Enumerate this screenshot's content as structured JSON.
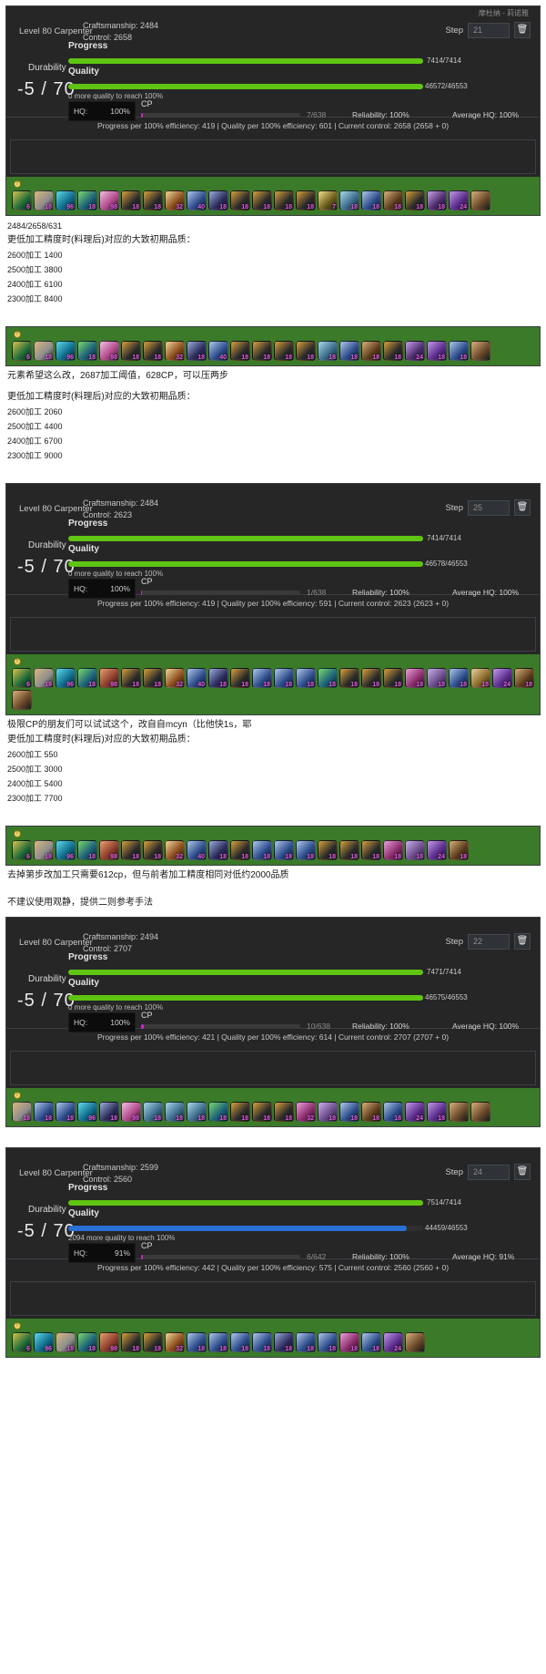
{
  "panels": [
    {
      "id": "panel-1",
      "server": "摩杜纳 - 莉诺雅",
      "job": "Level 80 Carpenter",
      "craftsmanship_label": "Craftsmanship: 2484",
      "control_label": "Control: 2658",
      "step_label": "Step",
      "step_value": "21",
      "progress_label": "Progress",
      "quality_label": "Quality",
      "durability_label": "Durability",
      "durability_value": "-5 / 70",
      "progress_text": "7414/7414",
      "progress_pct": 100,
      "quality_text": "46572/46553",
      "quality_pct": 100,
      "quality_note": "0 more quality to reach 100%",
      "hq_label": "HQ:",
      "hq_value": "100%",
      "cp_label": "CP",
      "cp_text": "7/638",
      "cp_pct": 1,
      "reliability": "Reliability: 100%",
      "average_hq": "Average HQ: 100%",
      "efficiency": "Progress per 100% efficiency: 419 | Quality per 100% efficiency: 601 | Current control: 2658 (2658 + 0)",
      "quality_bar_color": "#5fc412",
      "actions": [
        {
          "cost": "6",
          "c1": "#1f6b3a",
          "c2": "#d8c34a"
        },
        {
          "cost": "18",
          "c1": "#8d8d8d",
          "c2": "#d8b77a"
        },
        {
          "cost": "96",
          "c1": "#0e6a8a",
          "c2": "#5fd8e8"
        },
        {
          "cost": "18",
          "c1": "#1a5f7a",
          "c2": "#7ad86a"
        },
        {
          "cost": "98",
          "c1": "#b0468a",
          "c2": "#f0c0e0"
        },
        {
          "cost": "18",
          "c1": "#2a2a2a",
          "c2": "#d8a03a"
        },
        {
          "cost": "18",
          "c1": "#2a2a2a",
          "c2": "#d8a03a"
        },
        {
          "cost": "32",
          "c1": "#8a4a1a",
          "c2": "#f0d89a"
        },
        {
          "cost": "40",
          "c1": "#2a4a8a",
          "c2": "#b0c8e8"
        },
        {
          "cost": "18",
          "c1": "#2a2a5a",
          "c2": "#9aaed8"
        },
        {
          "cost": "18",
          "c1": "#2a2a2a",
          "c2": "#d8a03a"
        },
        {
          "cost": "18",
          "c1": "#2a2a2a",
          "c2": "#d8a03a"
        },
        {
          "cost": "18",
          "c1": "#2a2a2a",
          "c2": "#d8a03a"
        },
        {
          "cost": "18",
          "c1": "#2a2a2a",
          "c2": "#d8a03a"
        },
        {
          "cost": "7",
          "c1": "#6a5a1a",
          "c2": "#f0e08a"
        },
        {
          "cost": "18",
          "c1": "#3a6a8a",
          "c2": "#a8d8e8"
        },
        {
          "cost": "18",
          "c1": "#2a4a8a",
          "c2": "#b0c8e8"
        },
        {
          "cost": "18",
          "c1": "#5a3a1a",
          "c2": "#d8b07a"
        },
        {
          "cost": "18",
          "c1": "#2a2a2a",
          "c2": "#d8a03a"
        },
        {
          "cost": "18",
          "c1": "#4a2a6a",
          "c2": "#c8a0e8"
        },
        {
          "cost": "24",
          "c1": "#5a2a8a",
          "c2": "#c09ae8"
        },
        {
          "cost": "",
          "c1": "#6a4a2a",
          "c2": "#d8b07a"
        }
      ]
    },
    {
      "id": "panel-2",
      "actions": [
        {
          "cost": "6",
          "c1": "#1f6b3a",
          "c2": "#d8c34a"
        },
        {
          "cost": "18",
          "c1": "#8d8d8d",
          "c2": "#d8b77a"
        },
        {
          "cost": "96",
          "c1": "#0e6a8a",
          "c2": "#5fd8e8"
        },
        {
          "cost": "18",
          "c1": "#1a5f7a",
          "c2": "#7ad86a"
        },
        {
          "cost": "98",
          "c1": "#b0468a",
          "c2": "#f0c0e0"
        },
        {
          "cost": "18",
          "c1": "#2a2a2a",
          "c2": "#d8a03a"
        },
        {
          "cost": "18",
          "c1": "#2a2a2a",
          "c2": "#d8a03a"
        },
        {
          "cost": "32",
          "c1": "#8a4a1a",
          "c2": "#f0d89a"
        },
        {
          "cost": "18",
          "c1": "#2a2a5a",
          "c2": "#9aaed8"
        },
        {
          "cost": "40",
          "c1": "#2a4a8a",
          "c2": "#b0c8e8"
        },
        {
          "cost": "18",
          "c1": "#2a2a2a",
          "c2": "#d8a03a"
        },
        {
          "cost": "18",
          "c1": "#2a2a2a",
          "c2": "#d8a03a"
        },
        {
          "cost": "18",
          "c1": "#2a2a2a",
          "c2": "#d8a03a"
        },
        {
          "cost": "18",
          "c1": "#2a2a2a",
          "c2": "#d8a03a"
        },
        {
          "cost": "18",
          "c1": "#3a6a8a",
          "c2": "#a8d8e8"
        },
        {
          "cost": "18",
          "c1": "#2a4a8a",
          "c2": "#b0c8e8"
        },
        {
          "cost": "18",
          "c1": "#5a3a1a",
          "c2": "#d8b07a"
        },
        {
          "cost": "18",
          "c1": "#2a2a2a",
          "c2": "#d8a03a"
        },
        {
          "cost": "24",
          "c1": "#4a2a6a",
          "c2": "#c8a0e8"
        },
        {
          "cost": "18",
          "c1": "#5a2a8a",
          "c2": "#c09ae8"
        },
        {
          "cost": "18",
          "c1": "#2a4a8a",
          "c2": "#b0c8e8"
        },
        {
          "cost": "",
          "c1": "#6a4a2a",
          "c2": "#d8b07a"
        }
      ]
    },
    {
      "id": "panel-3",
      "job": "Level 80 Carpenter",
      "craftsmanship_label": "Craftsmanship: 2484",
      "control_label": "Control: 2623",
      "step_label": "Step",
      "step_value": "25",
      "progress_label": "Progress",
      "quality_label": "Quality",
      "durability_label": "Durability",
      "durability_value": "-5 / 70",
      "progress_text": "7414/7414",
      "progress_pct": 100,
      "quality_text": "46578/46553",
      "quality_pct": 100,
      "quality_note": "0 more quality to reach 100%",
      "hq_label": "HQ:",
      "hq_value": "100%",
      "cp_label": "CP",
      "cp_text": "1/638",
      "cp_pct": 0.5,
      "reliability": "Reliability: 100%",
      "average_hq": "Average HQ: 100%",
      "efficiency": "Progress per 100% efficiency: 419 | Quality per 100% efficiency: 591 | Current control: 2623 (2623 + 0)",
      "quality_bar_color": "#5fc412",
      "actions": [
        {
          "cost": "6",
          "c1": "#1f6b3a",
          "c2": "#d8c34a"
        },
        {
          "cost": "18",
          "c1": "#8d8d8d",
          "c2": "#d8b77a"
        },
        {
          "cost": "96",
          "c1": "#0e6a8a",
          "c2": "#5fd8e8"
        },
        {
          "cost": "18",
          "c1": "#1a5f7a",
          "c2": "#7ad86a"
        },
        {
          "cost": "98",
          "c1": "#8a3a2a",
          "c2": "#e8a070"
        },
        {
          "cost": "18",
          "c1": "#2a2a2a",
          "c2": "#d8a03a"
        },
        {
          "cost": "18",
          "c1": "#2a2a2a",
          "c2": "#d8a03a"
        },
        {
          "cost": "32",
          "c1": "#8a4a1a",
          "c2": "#f0d89a"
        },
        {
          "cost": "40",
          "c1": "#2a4a8a",
          "c2": "#b0c8e8"
        },
        {
          "cost": "18",
          "c1": "#2a2a5a",
          "c2": "#9aaed8"
        },
        {
          "cost": "18",
          "c1": "#2a2a2a",
          "c2": "#d8a03a"
        },
        {
          "cost": "18",
          "c1": "#2a4a8a",
          "c2": "#b0c8e8"
        },
        {
          "cost": "18",
          "c1": "#2a4a8a",
          "c2": "#b0c8e8"
        },
        {
          "cost": "18",
          "c1": "#2a4a8a",
          "c2": "#b0c8e8"
        },
        {
          "cost": "18",
          "c1": "#1a5f7a",
          "c2": "#7ad86a"
        },
        {
          "cost": "18",
          "c1": "#2a2a2a",
          "c2": "#d8a03a"
        },
        {
          "cost": "18",
          "c1": "#2a2a2a",
          "c2": "#d8a03a"
        },
        {
          "cost": "18",
          "c1": "#2a2a2a",
          "c2": "#d8a03a"
        },
        {
          "cost": "18",
          "c1": "#8a2a6a",
          "c2": "#e8a0d8"
        },
        {
          "cost": "18",
          "c1": "#6a4a8a",
          "c2": "#c8b0e8"
        },
        {
          "cost": "18",
          "c1": "#2a4a8a",
          "c2": "#b0c8e8"
        },
        {
          "cost": "18",
          "c1": "#8a6a2a",
          "c2": "#e8d09a"
        },
        {
          "cost": "24",
          "c1": "#5a2a8a",
          "c2": "#c09ae8"
        },
        {
          "cost": "18",
          "c1": "#5a3a1a",
          "c2": "#d8b07a"
        },
        {
          "cost": "",
          "c1": "#6a4a2a",
          "c2": "#d8b07a"
        }
      ]
    },
    {
      "id": "panel-4",
      "actions": [
        {
          "cost": "6",
          "c1": "#1f6b3a",
          "c2": "#d8c34a"
        },
        {
          "cost": "18",
          "c1": "#8d8d8d",
          "c2": "#d8b77a"
        },
        {
          "cost": "96",
          "c1": "#0e6a8a",
          "c2": "#5fd8e8"
        },
        {
          "cost": "18",
          "c1": "#1a5f7a",
          "c2": "#7ad86a"
        },
        {
          "cost": "98",
          "c1": "#8a3a2a",
          "c2": "#e8a070"
        },
        {
          "cost": "18",
          "c1": "#2a2a2a",
          "c2": "#d8a03a"
        },
        {
          "cost": "18",
          "c1": "#2a2a2a",
          "c2": "#d8a03a"
        },
        {
          "cost": "32",
          "c1": "#8a4a1a",
          "c2": "#f0d89a"
        },
        {
          "cost": "40",
          "c1": "#2a4a8a",
          "c2": "#b0c8e8"
        },
        {
          "cost": "18",
          "c1": "#2a2a5a",
          "c2": "#9aaed8"
        },
        {
          "cost": "18",
          "c1": "#2a2a2a",
          "c2": "#d8a03a"
        },
        {
          "cost": "18",
          "c1": "#2a4a8a",
          "c2": "#b0c8e8"
        },
        {
          "cost": "18",
          "c1": "#2a4a8a",
          "c2": "#b0c8e8"
        },
        {
          "cost": "18",
          "c1": "#2a4a8a",
          "c2": "#b0c8e8"
        },
        {
          "cost": "18",
          "c1": "#2a2a2a",
          "c2": "#d8a03a"
        },
        {
          "cost": "18",
          "c1": "#2a2a2a",
          "c2": "#d8a03a"
        },
        {
          "cost": "18",
          "c1": "#2a2a2a",
          "c2": "#d8a03a"
        },
        {
          "cost": "18",
          "c1": "#8a2a6a",
          "c2": "#e8a0d8"
        },
        {
          "cost": "18",
          "c1": "#6a4a8a",
          "c2": "#c8b0e8"
        },
        {
          "cost": "24",
          "c1": "#5a2a8a",
          "c2": "#c09ae8"
        },
        {
          "cost": "18",
          "c1": "#5a3a1a",
          "c2": "#d8b07a"
        }
      ]
    },
    {
      "id": "panel-5",
      "job": "Level 80 Carpenter",
      "craftsmanship_label": "Craftsmanship: 2494",
      "control_label": "Control: 2707",
      "step_label": "Step",
      "step_value": "22",
      "progress_label": "Progress",
      "quality_label": "Quality",
      "durability_label": "Durability",
      "durability_value": "-5 / 70",
      "progress_text": "7471/7414",
      "progress_pct": 100,
      "quality_text": "46575/46553",
      "quality_pct": 100,
      "quality_note": "0 more quality to reach 100%",
      "hq_label": "HQ:",
      "hq_value": "100%",
      "cp_label": "CP",
      "cp_text": "10/638",
      "cp_pct": 1.5,
      "reliability": "Reliability: 100%",
      "average_hq": "Average HQ: 100%",
      "efficiency": "Progress per 100% efficiency: 421 | Quality per 100% efficiency: 614 | Current control: 2707 (2707 + 0)",
      "quality_bar_color": "#5fc412",
      "actions": [
        {
          "cost": "18",
          "c1": "#8d8d8d",
          "c2": "#d8b77a"
        },
        {
          "cost": "18",
          "c1": "#2a4a8a",
          "c2": "#b0c8e8"
        },
        {
          "cost": "18",
          "c1": "#2a4a8a",
          "c2": "#b0c8e8"
        },
        {
          "cost": "96",
          "c1": "#0e6a8a",
          "c2": "#5fd8e8"
        },
        {
          "cost": "18",
          "c1": "#2a2a5a",
          "c2": "#9aaed8"
        },
        {
          "cost": "98",
          "c1": "#b0468a",
          "c2": "#f0c0e0"
        },
        {
          "cost": "18",
          "c1": "#3a6a8a",
          "c2": "#a8d8e8"
        },
        {
          "cost": "18",
          "c1": "#3a6a8a",
          "c2": "#a8d8e8"
        },
        {
          "cost": "18",
          "c1": "#3a6a8a",
          "c2": "#a8d8e8"
        },
        {
          "cost": "18",
          "c1": "#1a5f7a",
          "c2": "#7ad86a"
        },
        {
          "cost": "18",
          "c1": "#2a2a2a",
          "c2": "#d8a03a"
        },
        {
          "cost": "18",
          "c1": "#2a2a2a",
          "c2": "#d8a03a"
        },
        {
          "cost": "18",
          "c1": "#2a2a2a",
          "c2": "#d8a03a"
        },
        {
          "cost": "32",
          "c1": "#8a2a6a",
          "c2": "#e8a0d8"
        },
        {
          "cost": "18",
          "c1": "#6a4a8a",
          "c2": "#c8b0e8"
        },
        {
          "cost": "18",
          "c1": "#2a4a8a",
          "c2": "#b0c8e8"
        },
        {
          "cost": "18",
          "c1": "#5a3a1a",
          "c2": "#d8b07a"
        },
        {
          "cost": "18",
          "c1": "#2a4a8a",
          "c2": "#b0c8e8"
        },
        {
          "cost": "24",
          "c1": "#5a2a8a",
          "c2": "#c09ae8"
        },
        {
          "cost": "18",
          "c1": "#5a2a8a",
          "c2": "#c09ae8"
        },
        {
          "cost": "",
          "c1": "#6a4a2a",
          "c2": "#d8b07a"
        },
        {
          "cost": "",
          "c1": "#6a4a2a",
          "c2": "#d8b07a"
        }
      ]
    },
    {
      "id": "panel-6",
      "job": "Level 80 Carpenter",
      "craftsmanship_label": "Craftsmanship: 2599",
      "control_label": "Control: 2560",
      "step_label": "Step",
      "step_value": "24",
      "progress_label": "Progress",
      "quality_label": "Quality",
      "durability_label": "Durability",
      "durability_value": "-5 / 70",
      "progress_text": "7514/7414",
      "progress_pct": 100,
      "quality_text": "44459/46553",
      "quality_pct": 95.5,
      "quality_note": "2094 more quality to reach 100%",
      "hq_label": "HQ:",
      "hq_value": "91%",
      "cp_label": "CP",
      "cp_text": "6/642",
      "cp_pct": 1,
      "reliability": "Reliability: 100%",
      "average_hq": "Average HQ: 91%",
      "efficiency": "Progress per 100% efficiency: 442 | Quality per 100% efficiency: 575 | Current control: 2560 (2560 + 0)",
      "quality_bar_color": "#2a6fd6",
      "actions": [
        {
          "cost": "6",
          "c1": "#1f6b3a",
          "c2": "#d8c34a"
        },
        {
          "cost": "96",
          "c1": "#0e6a8a",
          "c2": "#5fd8e8"
        },
        {
          "cost": "18",
          "c1": "#8d8d8d",
          "c2": "#d8b77a"
        },
        {
          "cost": "18",
          "c1": "#1a5f7a",
          "c2": "#7ad86a"
        },
        {
          "cost": "98",
          "c1": "#8a3a2a",
          "c2": "#e8a070"
        },
        {
          "cost": "18",
          "c1": "#2a2a2a",
          "c2": "#d8a03a"
        },
        {
          "cost": "18",
          "c1": "#2a2a2a",
          "c2": "#d8a03a"
        },
        {
          "cost": "32",
          "c1": "#8a4a1a",
          "c2": "#f0d89a"
        },
        {
          "cost": "18",
          "c1": "#2a4a8a",
          "c2": "#b0c8e8"
        },
        {
          "cost": "18",
          "c1": "#2a4a8a",
          "c2": "#b0c8e8"
        },
        {
          "cost": "18",
          "c1": "#2a4a8a",
          "c2": "#b0c8e8"
        },
        {
          "cost": "18",
          "c1": "#2a4a8a",
          "c2": "#b0c8e8"
        },
        {
          "cost": "18",
          "c1": "#2a2a5a",
          "c2": "#9aaed8"
        },
        {
          "cost": "18",
          "c1": "#2a4a8a",
          "c2": "#b0c8e8"
        },
        {
          "cost": "18",
          "c1": "#2a4a8a",
          "c2": "#b0c8e8"
        },
        {
          "cost": "18",
          "c1": "#8a2a6a",
          "c2": "#e8a0d8"
        },
        {
          "cost": "18",
          "c1": "#2a4a8a",
          "c2": "#b0c8e8"
        },
        {
          "cost": "24",
          "c1": "#5a2a8a",
          "c2": "#c09ae8"
        },
        {
          "cost": "",
          "c1": "#6a4a2a",
          "c2": "#d8b07a"
        }
      ]
    }
  ],
  "notes": {
    "n1_stats": "2484/2658/631",
    "n1_title": "更低加工精度时(料理后)对应的大致初期品质：",
    "n1_rows": [
      "2600加工 1400",
      "2500加工 3800",
      "2400加工 6100",
      "2300加工 8400"
    ],
    "n2_head": "元素希望这么改，2687加工阈值，628CP，可以压两步",
    "n2_title": "更低加工精度时(料理后)对应的大致初期品质：",
    "n2_rows": [
      "2600加工 2060",
      "2500加工 4400",
      "2400加工 6700",
      "2300加工 9000"
    ],
    "n3_head": "极限CP的朋友们可以试试这个，改自自mcyn（比他快1s，耶",
    "n3_title": "更低加工精度时(料理后)对应的大致初期品质：",
    "n3_rows": [
      "2600加工 550",
      "2500加工 3000",
      "2400加工 5400",
      "2300加工 7700"
    ],
    "n4_head": "去掉第步改加工只需要612cp，但与前者加工精度相同对低约2000品质",
    "n4_sub": "不建议使用观静，提供二则参考手法"
  }
}
